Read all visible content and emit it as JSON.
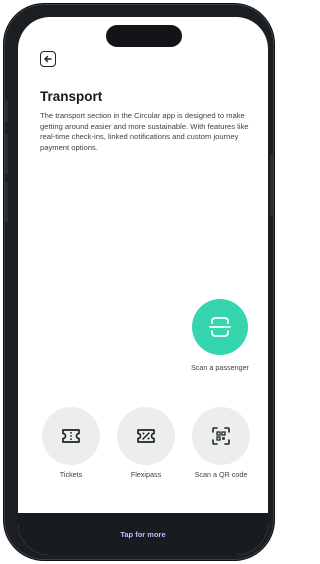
{
  "header": {
    "back_icon": "back-arrow-icon"
  },
  "content": {
    "title": "Transport",
    "description": "The transport section in the Circular app is designed to make getting around easier and more sustainable. With features like real-time  check-ins, linked notifications and custom journey payment options."
  },
  "scan_passenger": {
    "label": "Scan a passenger",
    "icon": "scan-frame-icon",
    "color": "#35d5ae"
  },
  "actions": [
    {
      "label": "Tickets",
      "icon": "ticket-icon"
    },
    {
      "label": "Flexipass",
      "icon": "flexipass-ticket-icon"
    },
    {
      "label": "Scan a QR code",
      "icon": "qr-scan-icon"
    }
  ],
  "bottom_bar": {
    "label": "Tap for more",
    "label_color": "#c9b6ff",
    "background": "#181b20"
  }
}
